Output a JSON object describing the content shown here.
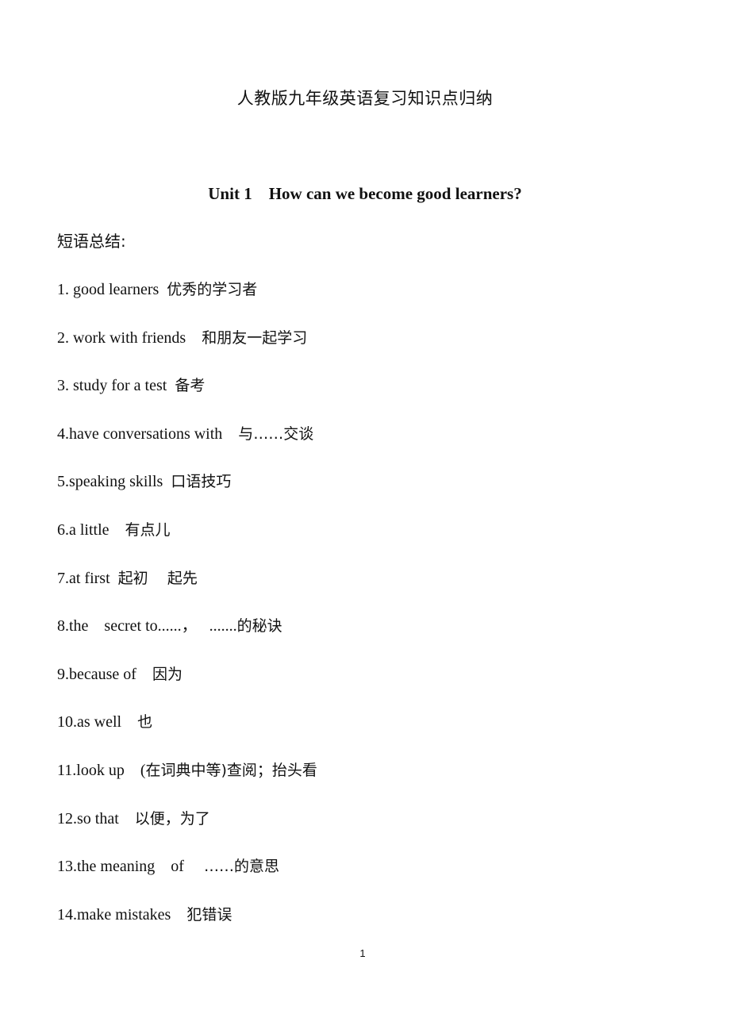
{
  "document": {
    "title": "人教版九年级英语复习知识点归纳",
    "unit_heading": "Unit 1    How can we become good learners?",
    "section_label": "短语总结:",
    "phrases": [
      {
        "en": "1. good learners  ",
        "zh": "优秀的学习者"
      },
      {
        "en": "2. work with friends    ",
        "zh": "和朋友一起学习"
      },
      {
        "en": "3. study for a test  ",
        "zh": "备考"
      },
      {
        "en": "4.have conversations with    ",
        "zh": "与……交谈"
      },
      {
        "en": "5.speaking skills  ",
        "zh": "口语技巧"
      },
      {
        "en": "6.a little    ",
        "zh": "有点儿"
      },
      {
        "en": "7.at first  ",
        "zh": "起初    起先"
      },
      {
        "en": "8.the    secret to......，   .......",
        "zh": "的秘诀"
      },
      {
        "en": "9.because of    ",
        "zh": "因为"
      },
      {
        "en": "10.as well    ",
        "zh": "也"
      },
      {
        "en": "11.look up    (",
        "zh": "在词典中等)查阅；抬头看"
      },
      {
        "en": "12.so that    ",
        "zh": "以便，为了"
      },
      {
        "en": "13.the meaning    of     ",
        "zh": "……的意思"
      },
      {
        "en": "14.make mistakes    ",
        "zh": "犯错误"
      }
    ],
    "page_number": "1"
  }
}
